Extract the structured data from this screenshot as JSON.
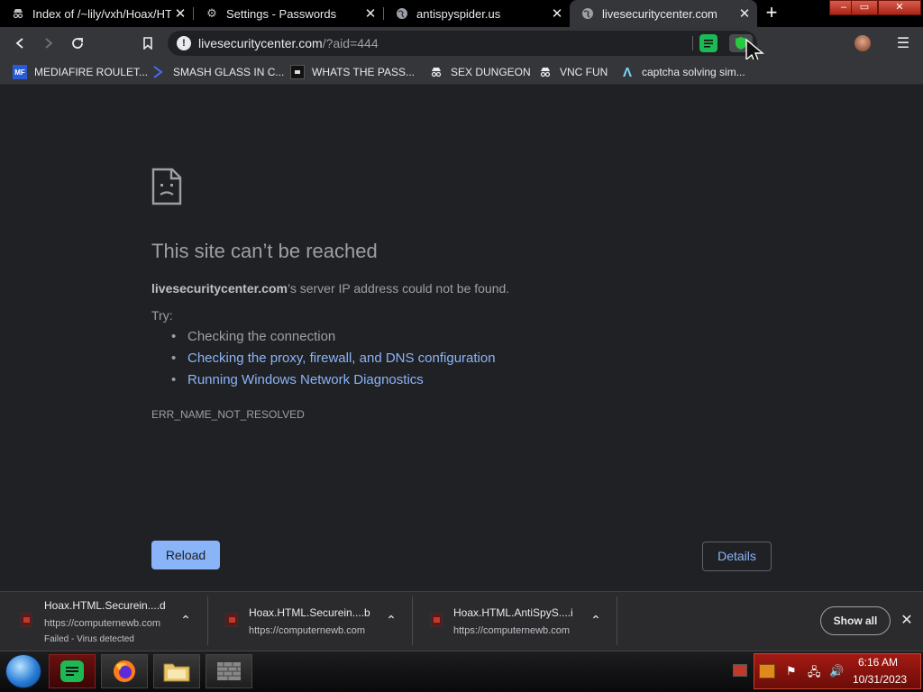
{
  "tabs": [
    {
      "label": "Index of /~lily/vxh/Hoax/HT",
      "icon": "spy-icon",
      "active": false
    },
    {
      "label": "Settings - Passwords",
      "icon": "gear-icon",
      "active": false
    },
    {
      "label": "antispyspider.us",
      "icon": "globe-icon",
      "active": false
    },
    {
      "label": "livesecuritycenter.com",
      "icon": "globe-icon",
      "active": true
    }
  ],
  "toolbar": {
    "url_host": "livesecuritycenter.com",
    "url_path": "/?aid=444",
    "info_glyph": "!"
  },
  "bookmarks": [
    {
      "label": "MEDIAFIRE ROULET...",
      "icon": "mediafire-icon"
    },
    {
      "label": "SMASH GLASS IN C...",
      "icon": "chevron-bookmark-icon"
    },
    {
      "label": "WHATS THE PASS...",
      "icon": "dark-box-icon"
    },
    {
      "label": "SEX DUNGEON",
      "icon": "spy-icon"
    },
    {
      "label": "VNC FUN",
      "icon": "spy-icon"
    },
    {
      "label": "captcha solving sim...",
      "icon": "lambda-icon"
    }
  ],
  "error": {
    "title": "This site can’t be reached",
    "host_bold": "livesecuritycenter.com",
    "desc_rest": "’s server IP address could not be found.",
    "try_label": "Try:",
    "suggestions": [
      "Checking the connection",
      "Checking the proxy, firewall, and DNS configuration",
      "Running Windows Network Diagnostics"
    ],
    "code": "ERR_NAME_NOT_RESOLVED",
    "reload_label": "Reload",
    "details_label": "Details"
  },
  "downloads": [
    {
      "name": "Hoax.HTML.Securein....d",
      "url": "https://computernewb.com",
      "status": "Failed - Virus detected"
    },
    {
      "name": "Hoax.HTML.Securein....b",
      "url": "https://computernewb.com",
      "status": ""
    },
    {
      "name": "Hoax.HTML.AntiSpyS....i",
      "url": "https://computernewb.com",
      "status": ""
    }
  ],
  "download_shelf": {
    "show_all_label": "Show all"
  },
  "taskbar": {
    "time": "6:16 AM",
    "date": "10/31/2023"
  },
  "colors": {
    "accent": "#8ab4f8",
    "page_bg": "#202124",
    "tray_red": "#a41a12"
  }
}
